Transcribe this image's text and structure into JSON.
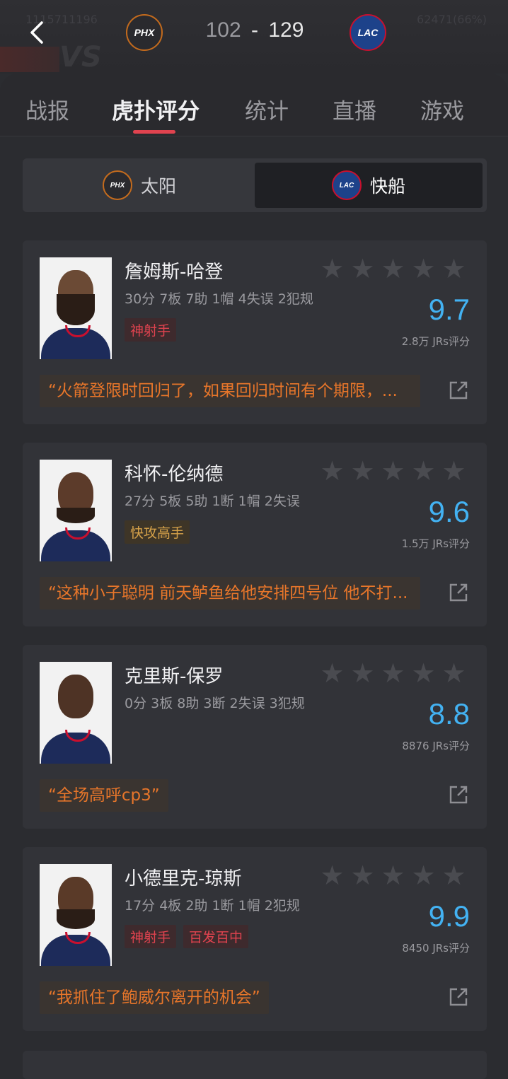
{
  "header": {
    "ghost_left": "1115711196",
    "ghost_right": "62471(66%)",
    "ghost_vs": "VS",
    "home_logo_text": "PHX",
    "away_logo_text": "LAC",
    "home_score": "102",
    "separator": "-",
    "away_score": "129"
  },
  "tabs": [
    {
      "label": "战报"
    },
    {
      "label": "虎扑评分"
    },
    {
      "label": "统计"
    },
    {
      "label": "直播"
    },
    {
      "label": "游戏"
    }
  ],
  "team_toggle": {
    "left": {
      "logo": "PHX",
      "label": "太阳"
    },
    "right": {
      "logo": "LAC",
      "label": "快船"
    }
  },
  "players": [
    {
      "name": "詹姆斯-哈登",
      "stats": "30分 7板 7助 1帽 4失误 2犯规",
      "tags": [
        {
          "text": "神射手",
          "style": "red"
        }
      ],
      "rating": "9.7",
      "votes": "2.8万 JRs评分",
      "comment": "“火箭登限时回归了，如果回归时间有个期限，..."
    },
    {
      "name": "科怀-伦纳德",
      "stats": "27分 5板 5助 1断 1帽 2失误",
      "tags": [
        {
          "text": "快攻高手",
          "style": "gold"
        }
      ],
      "rating": "9.6",
      "votes": "1.5万 JRs评分",
      "comment": "“这种小子聪明 前天鲈鱼给他安排四号位 他不打..."
    },
    {
      "name": "克里斯-保罗",
      "stats": "0分 3板 8助 3断 2失误 3犯规",
      "tags": [],
      "rating": "8.8",
      "votes": "8876 JRs评分",
      "comment": "“全场高呼cp3”"
    },
    {
      "name": "小德里克-琼斯",
      "stats": "17分 4板 2助 1断 1帽 2犯规",
      "tags": [
        {
          "text": "神射手",
          "style": "red"
        },
        {
          "text": "百发百中",
          "style": "red"
        }
      ],
      "rating": "9.9",
      "votes": "8450 JRs评分",
      "comment": "“我抓住了鲍威尔离开的机会”"
    }
  ],
  "colors": {
    "accent": "#e0434f",
    "rating": "#43b2f2",
    "comment": "#e8762a"
  }
}
